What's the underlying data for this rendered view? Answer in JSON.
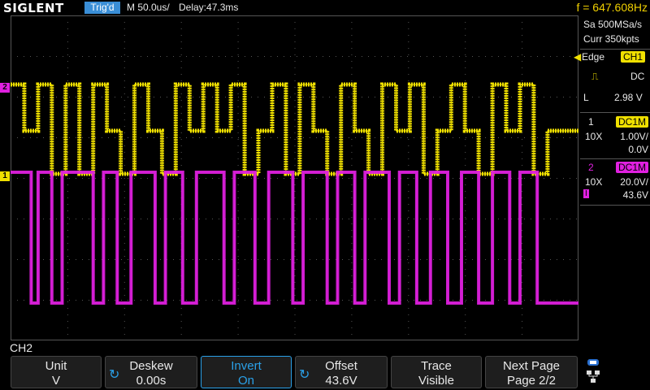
{
  "header": {
    "brand": "SIGLENT",
    "trigger_status": "Trig'd",
    "timebase": "M 50.0us/",
    "delay": "Delay:47.3ms",
    "frequency": "f = 647.608Hz"
  },
  "acquisition": {
    "sample_rate": "Sa 500MSa/s",
    "memory_depth": "Curr 350kpts"
  },
  "trigger": {
    "type": "Edge",
    "source": "CH1",
    "slope_icon": "rising-edge-icon",
    "coupling": "DC",
    "level_label": "L",
    "level": "2.98 V"
  },
  "channels": [
    {
      "id": "1",
      "coupling": "DC1M",
      "probe": "10X",
      "scale": "1.00V/",
      "offset": "0.0V",
      "color": "#f0e000"
    },
    {
      "id": "2",
      "coupling": "DC1M",
      "probe": "10X",
      "scale": "20.0V/",
      "offset": "43.6V",
      "color": "#e020e0",
      "invert_mark": "I"
    }
  ],
  "markers": {
    "ch1": "1",
    "ch2": "2"
  },
  "active_menu": "CH2",
  "menu": [
    {
      "title": "Unit",
      "value": "V",
      "knob": false
    },
    {
      "title": "Deskew",
      "value": "0.00s",
      "knob": true
    },
    {
      "title": "Invert",
      "value": "On",
      "knob": false,
      "active": true
    },
    {
      "title": "Offset",
      "value": "43.6V",
      "knob": true
    },
    {
      "title": "Trace",
      "value": "Visible",
      "knob": false
    },
    {
      "title": "Next Page",
      "value": "Page 2/2",
      "knob": false
    }
  ],
  "waveforms": {
    "ch1": {
      "color": "#f0e000",
      "segments": [
        [
          "H",
          0,
          8
        ],
        [
          "M",
          8,
          16
        ],
        [
          "H",
          16,
          24
        ],
        [
          "L",
          24,
          32
        ],
        [
          "H",
          32,
          40
        ],
        [
          "L",
          40,
          48
        ],
        [
          "H",
          48,
          56
        ],
        [
          "M",
          56,
          64
        ],
        [
          "L",
          64,
          72
        ],
        [
          "H",
          72,
          80
        ],
        [
          "M",
          80,
          88
        ],
        [
          "L",
          88,
          96
        ],
        [
          "H",
          96,
          104
        ],
        [
          "M",
          104,
          112
        ],
        [
          "H",
          112,
          120
        ],
        [
          "M",
          120,
          128
        ],
        [
          "H",
          128,
          136
        ],
        [
          "L",
          136,
          144
        ],
        [
          "M",
          144,
          152
        ],
        [
          "H",
          152,
          160
        ],
        [
          "L",
          160,
          168
        ],
        [
          "H",
          168,
          176
        ],
        [
          "M",
          176,
          184
        ],
        [
          "L",
          184,
          192
        ],
        [
          "H",
          192,
          200
        ],
        [
          "M",
          200,
          208
        ],
        [
          "L",
          208,
          216
        ],
        [
          "H",
          216,
          224
        ],
        [
          "M",
          224,
          232
        ],
        [
          "H",
          232,
          240
        ],
        [
          "L",
          240,
          248
        ],
        [
          "M",
          248,
          256
        ],
        [
          "H",
          256,
          264
        ],
        [
          "M",
          264,
          272
        ],
        [
          "L",
          272,
          280
        ],
        [
          "H",
          280,
          288
        ],
        [
          "M",
          288,
          296
        ],
        [
          "H",
          296,
          304
        ],
        [
          "L",
          304,
          312
        ],
        [
          "M",
          312,
          330
        ]
      ]
    },
    "ch2": {
      "color": "#e020e0",
      "segments": [
        [
          "U",
          0,
          12
        ],
        [
          "D",
          12,
          16
        ],
        [
          "U",
          16,
          24
        ],
        [
          "D",
          24,
          30
        ],
        [
          "U",
          30,
          48
        ],
        [
          "D",
          48,
          54
        ],
        [
          "U",
          54,
          62
        ],
        [
          "D",
          62,
          70
        ],
        [
          "U",
          70,
          84
        ],
        [
          "D",
          84,
          90
        ],
        [
          "U",
          90,
          100
        ],
        [
          "D",
          100,
          108
        ],
        [
          "U",
          108,
          124
        ],
        [
          "D",
          124,
          130
        ],
        [
          "U",
          130,
          142
        ],
        [
          "D",
          142,
          150
        ],
        [
          "U",
          150,
          164
        ],
        [
          "D",
          164,
          170
        ],
        [
          "U",
          170,
          184
        ],
        [
          "D",
          184,
          190
        ],
        [
          "U",
          190,
          200
        ],
        [
          "D",
          200,
          206
        ],
        [
          "U",
          206,
          220
        ],
        [
          "D",
          220,
          226
        ],
        [
          "U",
          226,
          236
        ],
        [
          "D",
          236,
          244
        ],
        [
          "U",
          244,
          254
        ],
        [
          "D",
          254,
          262
        ],
        [
          "U",
          262,
          272
        ],
        [
          "D",
          272,
          280
        ],
        [
          "U",
          280,
          290
        ],
        [
          "D",
          290,
          296
        ],
        [
          "U",
          296,
          306
        ],
        [
          "D",
          306,
          330
        ]
      ]
    }
  }
}
